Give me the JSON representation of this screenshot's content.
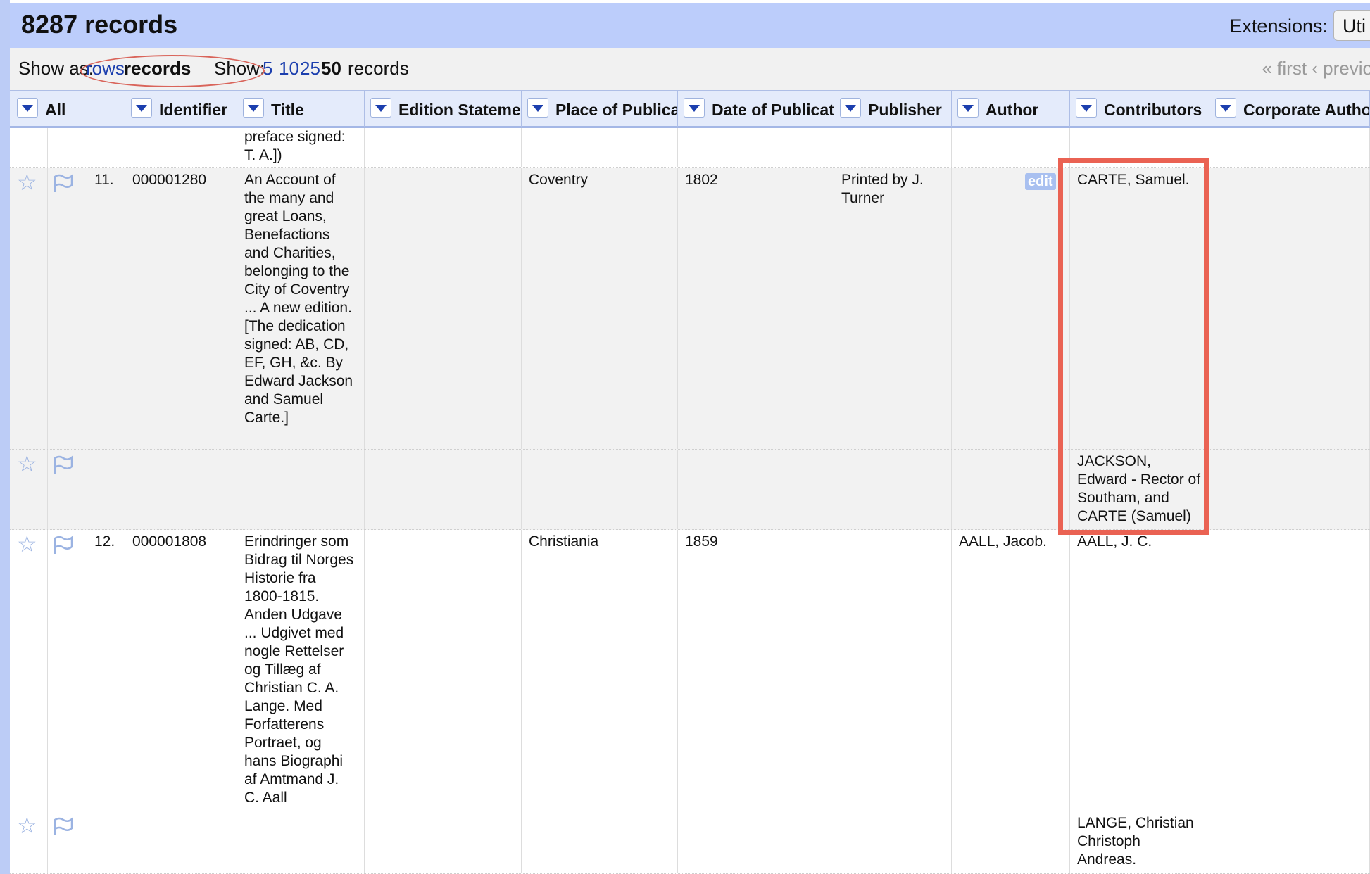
{
  "header": {
    "records_count": "8287 records",
    "extensions_label": "Extensions:",
    "extensions_button": "Uti"
  },
  "viewbar": {
    "show_as_label": "Show as:",
    "rows_link": "rows",
    "records_mode": "records",
    "show_label": "Show:",
    "page_sizes": [
      "5",
      "10",
      "25",
      "50"
    ],
    "records_word": "records",
    "pager": "« first  ‹ previo"
  },
  "columns": [
    "All",
    "Identifier",
    "Title",
    "Edition Statemer",
    "Place of Publicat",
    "Date of Publicati",
    "Publisher",
    "Author",
    "Contributors",
    "Corporate Autho"
  ],
  "rows": [
    {
      "num": "",
      "identifier": "",
      "title": "preface signed: T. A.])",
      "place": "",
      "date": "",
      "publisher": "",
      "author": "",
      "contributors": ""
    },
    {
      "num": "11.",
      "identifier": "000001280",
      "title": "An Account of the many and great Loans, Benefactions and Charities, belonging to the City of Coventry ... A new edition. [The dedication signed: AB, CD, EF, GH, &c. By Edward Jackson and Samuel Carte.]",
      "place": "Coventry",
      "date": "1802",
      "publisher": "Printed by J. Turner",
      "author": "",
      "contributors": "CARTE, Samuel."
    },
    {
      "num": "",
      "identifier": "",
      "title": "",
      "place": "",
      "date": "",
      "publisher": "",
      "author": "",
      "contributors": "JACKSON, Edward - Rector of Southam, and CARTE (Samuel)"
    },
    {
      "num": "12.",
      "identifier": "000001808",
      "title": "Erindringer som Bidrag til Norges Historie fra 1800-1815. Anden Udgave ... Udgivet med nogle Rettelser og Tillæg af Christian C. A. Lange. Med Forfatterens Portraet, og hans Biographi af Amtmand J. C. Aall",
      "place": "Christiania",
      "date": "1859",
      "publisher": "",
      "author": "AALL, Jacob.",
      "contributors": "AALL, J. C."
    },
    {
      "num": "",
      "identifier": "",
      "title": "",
      "place": "",
      "date": "",
      "publisher": "",
      "author": "",
      "contributors": "LANGE, Christian Christoph Andreas."
    }
  ],
  "edit_badge": "edit",
  "colors": {
    "header_bg": "#bccdfb",
    "link": "#1c3fae",
    "highlight": "#ea6253"
  }
}
